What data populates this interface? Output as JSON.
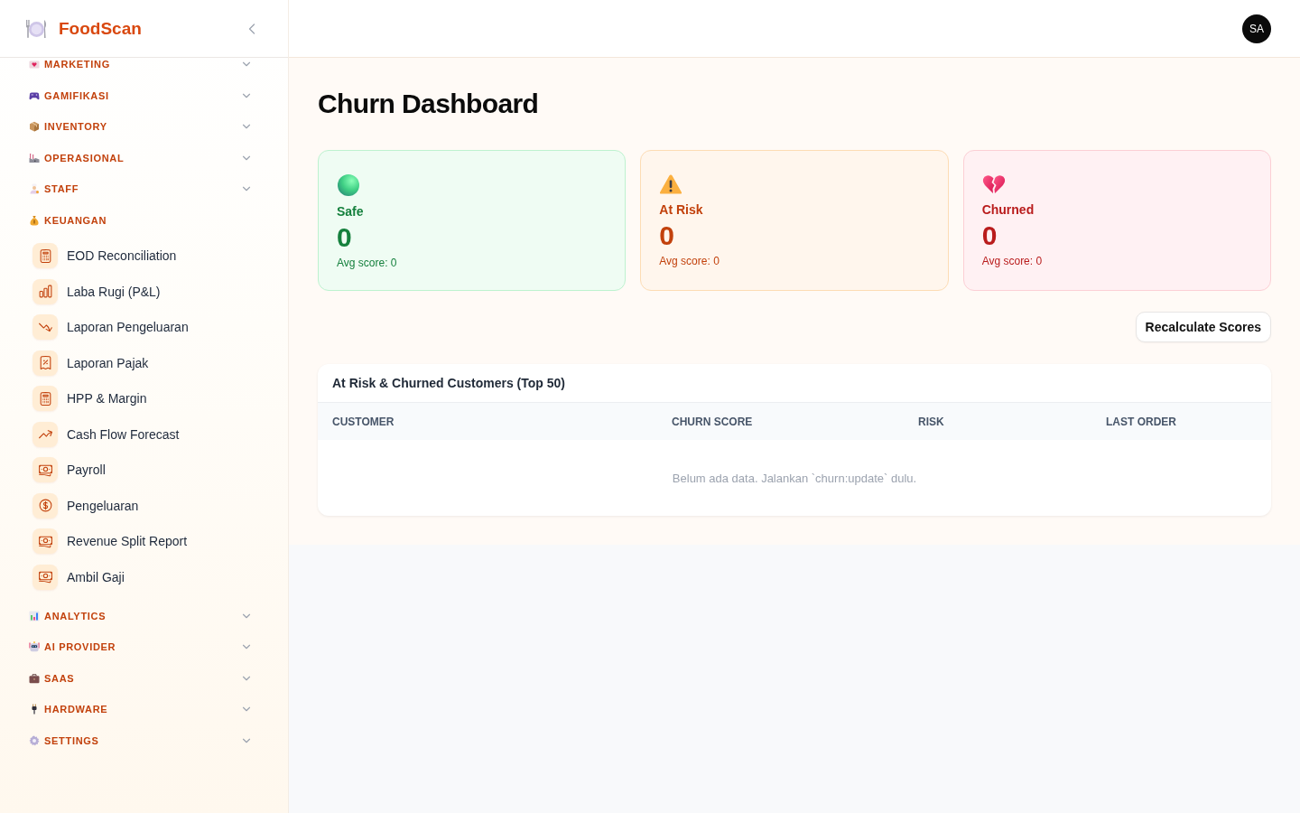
{
  "sidebar": {
    "brand": "FoodScan",
    "groups": [
      {
        "label": "MARKETING",
        "expanded": false
      },
      {
        "label": "GAMIFIKASI",
        "expanded": false
      },
      {
        "label": "INVENTORY",
        "expanded": false
      },
      {
        "label": "OPERASIONAL",
        "expanded": false
      },
      {
        "label": "STAFF",
        "expanded": false
      },
      {
        "label": "KEUANGAN",
        "expanded": true,
        "items": [
          {
            "label": "EOD Reconciliation",
            "selected": false
          },
          {
            "label": "Laba Rugi (P&L)",
            "selected": false
          },
          {
            "label": "Laporan Pengeluaran",
            "selected": false
          },
          {
            "label": "Laporan Pajak",
            "selected": false
          },
          {
            "label": "HPP & Margin",
            "selected": false
          },
          {
            "label": "Cash Flow Forecast",
            "selected": false
          },
          {
            "label": "Payroll",
            "selected": false
          },
          {
            "label": "Pengeluaran",
            "selected": false
          },
          {
            "label": "Revenue Split Report",
            "selected": false
          },
          {
            "label": "Ambil Gaji",
            "selected": false
          }
        ]
      },
      {
        "label": "ANALYTICS",
        "expanded": false
      },
      {
        "label": "AI PROVIDER",
        "expanded": false
      },
      {
        "label": "SAAS",
        "expanded": false
      },
      {
        "label": "HARDWARE",
        "expanded": false
      },
      {
        "label": "SETTINGS",
        "expanded": false
      }
    ]
  },
  "topbar": {
    "avatar": "SA"
  },
  "page": {
    "title": "Churn Dashboard"
  },
  "stats": [
    {
      "kind": "safe",
      "label": "Safe",
      "value": "0",
      "subtext": "Avg score: 0"
    },
    {
      "kind": "at_risk",
      "label": "At Risk",
      "value": "0",
      "subtext": "Avg score: 0"
    },
    {
      "kind": "churned",
      "label": "Churned",
      "value": "0",
      "subtext": "Avg score: 0"
    }
  ],
  "recalculate_button": "Recalculate Scores",
  "table": {
    "title": "At Risk & Churned Customers (Top 50)",
    "columns": [
      "CUSTOMER",
      "CHURN SCORE",
      "RISK",
      "LAST ORDER"
    ],
    "empty_message": "Belum ada data. Jalankan `churn:update` dulu."
  }
}
